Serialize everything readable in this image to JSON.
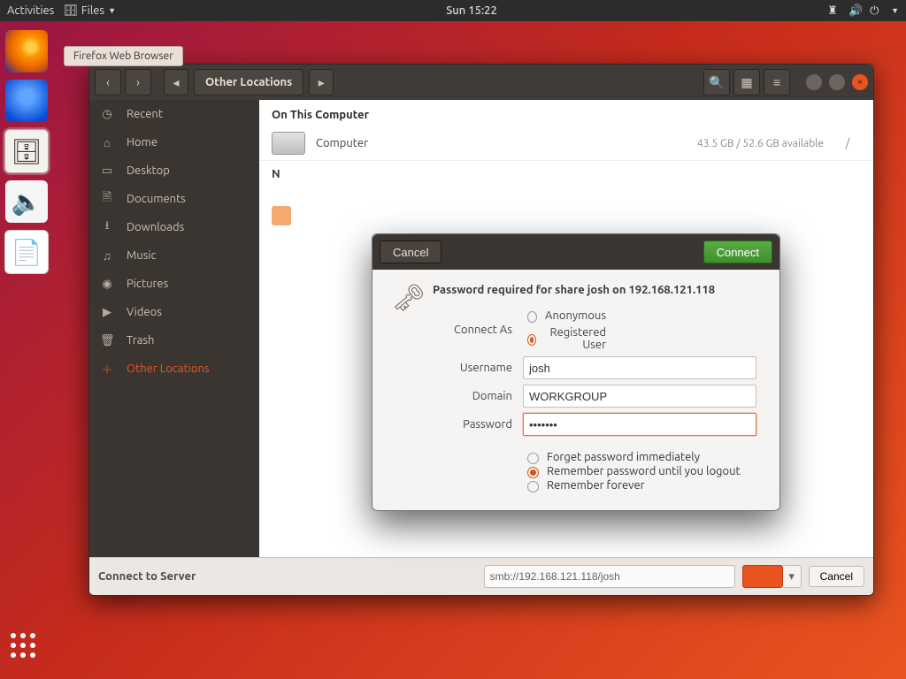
{
  "topbar": {
    "activities": "Activities",
    "app_menu": "Files",
    "clock": "Sun 15:22"
  },
  "tooltip": "Firefox Web Browser",
  "files": {
    "path_label": "Other Locations",
    "group_on_computer": "On This Computer",
    "device_name": "Computer",
    "device_stats": "43.5 GB / 52.6 GB available",
    "device_mount": "/",
    "group_network_initial": "N",
    "footer_label": "Connect to Server",
    "footer_address": "smb://192.168.121.118/josh",
    "footer_cancel": "Cancel"
  },
  "sidebar": {
    "items": [
      {
        "icon": "◷",
        "label": "Recent"
      },
      {
        "icon": "⌂",
        "label": "Home"
      },
      {
        "icon": "▭",
        "label": "Desktop"
      },
      {
        "icon": "🗎",
        "label": "Documents"
      },
      {
        "icon": "⭳",
        "label": "Downloads"
      },
      {
        "icon": "♫",
        "label": "Music"
      },
      {
        "icon": "◉",
        "label": "Pictures"
      },
      {
        "icon": "▶",
        "label": "Videos"
      },
      {
        "icon": "🗑",
        "label": "Trash"
      },
      {
        "icon": "＋",
        "label": "Other Locations"
      }
    ]
  },
  "dialog": {
    "cancel": "Cancel",
    "connect": "Connect",
    "title": "Password required for share josh on 192.168.121.118",
    "connect_as": "Connect As",
    "anon": "Anonymous",
    "reg": "Registered User",
    "username_label": "Username",
    "username": "josh",
    "domain_label": "Domain",
    "domain": "WORKGROUP",
    "password_label": "Password",
    "password": "•••••••",
    "forget": "Forget password immediately",
    "until_logout": "Remember password until you logout",
    "forever": "Remember forever"
  }
}
